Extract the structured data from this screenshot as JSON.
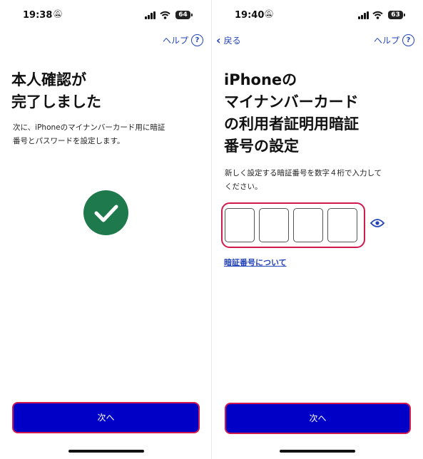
{
  "screen1": {
    "status": {
      "time": "19:38",
      "battery": "64"
    },
    "nav": {
      "help_label": "ヘルプ",
      "help_icon": "question-circle-icon"
    },
    "title_lines": [
      "本人確認が",
      "完了しました"
    ],
    "desc_lines": [
      "次に、iPhoneのマイナンバーカード用に暗証",
      "番号とパスワードを設定します。"
    ],
    "status_icon": "check-circle-icon",
    "next_label": "次へ"
  },
  "screen2": {
    "status": {
      "time": "19:40",
      "battery": "63"
    },
    "nav": {
      "back_label": "戻る",
      "help_label": "ヘルプ",
      "help_icon": "question-circle-icon"
    },
    "title_lines": [
      "iPhoneの",
      "マイナンバーカード",
      "の利用者証明用暗証",
      "番号の設定"
    ],
    "desc_lines": [
      "新しく設定する暗証番号を数字４桁で入力して",
      "ください。"
    ],
    "pin": {
      "digits": [
        "",
        "",
        "",
        ""
      ],
      "toggle_icon": "eye-icon"
    },
    "pin_link_label": "暗証番号について",
    "next_label": "次へ"
  },
  "colors": {
    "accent_blue": "#2343b8",
    "button_blue": "#0000c6",
    "highlight_red": "#d0194f",
    "success_green": "#1e7a4c"
  }
}
